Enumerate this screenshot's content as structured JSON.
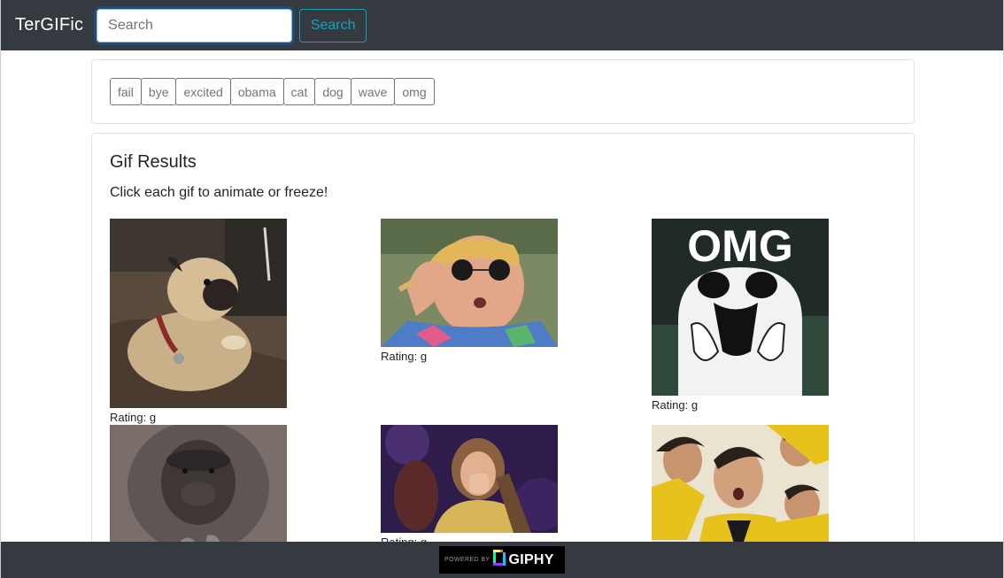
{
  "navbar": {
    "brand": "TerGIFic",
    "search_placeholder": "Search",
    "search_button": "Search"
  },
  "tags": [
    "fail",
    "bye",
    "excited",
    "obama",
    "cat",
    "dog",
    "wave",
    "omg"
  ],
  "results": {
    "title": "Gif Results",
    "subtitle": "Click each gif to animate or freeze!",
    "rating_prefix": "Rating: ",
    "gifs": [
      {
        "rating": "g",
        "subject": "pug dog on couch"
      },
      {
        "rating": "g",
        "subject": "man lowering sunglasses"
      },
      {
        "rating": "g",
        "subject": "OMG ghost",
        "caption": "OMG"
      },
      {
        "rating": "",
        "subject": "gorilla"
      },
      {
        "rating": "g",
        "subject": "surprised woman covering mouth"
      },
      {
        "rating": "",
        "subject": "man in yellow jacket"
      }
    ]
  },
  "footer": {
    "powered_by": "POWERED BY",
    "giphy": "GIPHY"
  },
  "colors": {
    "navbar_bg": "#343a40",
    "search_button": "#17a2b8",
    "tag_border": "#6c757d"
  }
}
